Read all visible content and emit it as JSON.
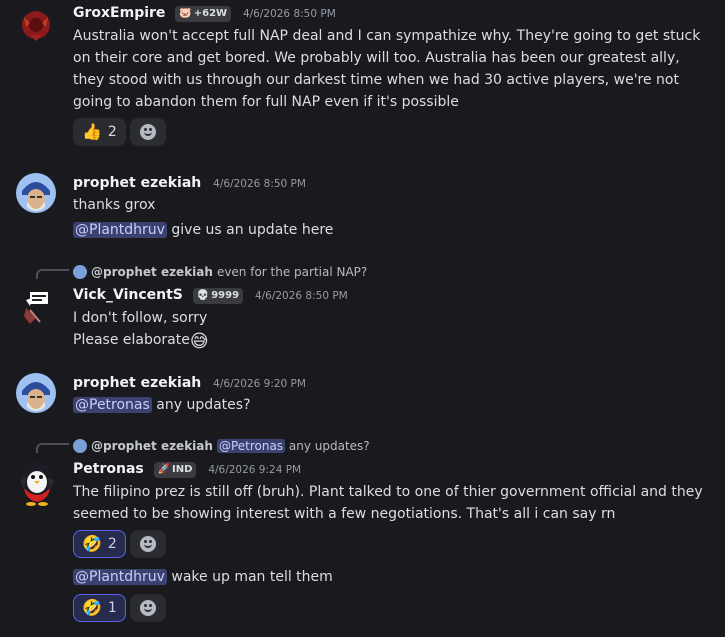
{
  "messages": {
    "grox": {
      "author": "GroxEmpire",
      "tag_icon": "pig-emoji",
      "tag": "+62W",
      "time": "4/6/2026 8:50 PM",
      "lines": [
        "Australia won't accept full NAP deal and I can sympathize why. They're going to get stuck",
        "on their core and get bored. We probably will too. Australia has been our greatest ally,",
        "they stood with us through our darkest time when we had 30 active players, we're not",
        "going to abandon them for full NAP even if it's possible"
      ],
      "reaction": {
        "emoji": "👍",
        "count": "2"
      }
    },
    "ezekiah1": {
      "author": "prophet ezekiah",
      "time": "4/6/2026 8:50 PM",
      "line1": "thanks grox",
      "mention": "@Plantdhruv",
      "line2_rest": " give us an update here"
    },
    "vick": {
      "reply_author": "@prophet ezekiah",
      "reply_text": "even for the partial NAP?",
      "author": "Vick_VincentS",
      "tag_icon": "skull-emoji",
      "tag": "9999",
      "time": "4/6/2026 8:50 PM",
      "line1": "I don't follow, sorry",
      "line2": "Please elaborate",
      "line2_emoji": "😅"
    },
    "ezekiah2": {
      "author": "prophet ezekiah",
      "time": "4/6/2026 9:20 PM",
      "mention": "@Petronas",
      "rest": " any updates?"
    },
    "petronas": {
      "reply_author": "@prophet ezekiah",
      "reply_mention": "@Petronas",
      "reply_text": " any updates?",
      "author": "Petronas",
      "tag_icon": "rocket-emoji",
      "tag": "IND",
      "time": "4/6/2026 9:24 PM",
      "line1": "The filipino prez is still off (bruh). Plant talked to one of thier government official and they",
      "line2": "seemed to be showing interest with a few negotiations. That's all i can say rn",
      "reaction": {
        "emoji": "🤣",
        "count": "2"
      }
    },
    "petronas2": {
      "mention": "@Plantdhruv",
      "rest": " wake up man tell them",
      "reaction": {
        "emoji": "🤣",
        "count": "1"
      }
    }
  }
}
